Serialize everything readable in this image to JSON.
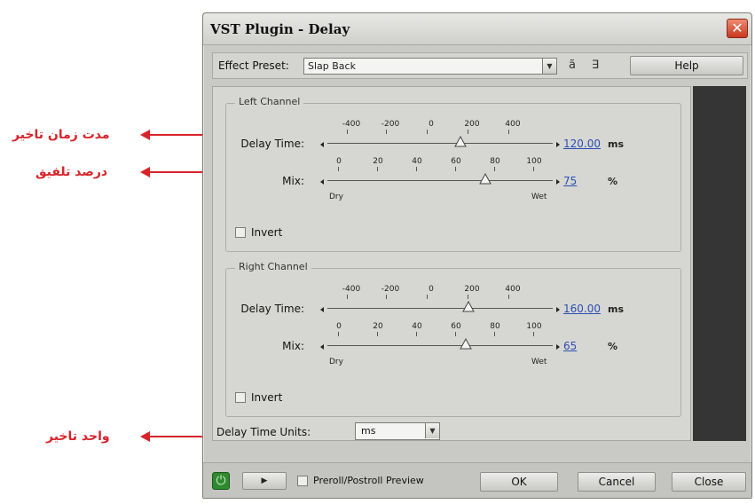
{
  "annotations": {
    "delay_time": "مدت زمان تاخیر",
    "mix": "درصد تلفیق",
    "units": "واحد تاخیر"
  },
  "dialog": {
    "title": "VST Plugin - Delay",
    "close_glyph": "✕"
  },
  "preset": {
    "label": "Effect Preset:",
    "value": "Slap Back",
    "help_label": "Help",
    "save_icon": "save-preset-icon",
    "delete_icon": "delete-preset-icon"
  },
  "left_channel": {
    "title": "Left Channel",
    "delay_label": "Delay Time:",
    "delay_value": "120.00",
    "delay_unit": "ms",
    "mix_label": "Mix:",
    "mix_value": "75",
    "mix_unit": "%",
    "dry": "Dry",
    "wet": "Wet",
    "invert_label": "Invert"
  },
  "right_channel": {
    "title": "Right Channel",
    "delay_label": "Delay Time:",
    "delay_value": "160.00",
    "delay_unit": "ms",
    "mix_label": "Mix:",
    "mix_value": "65",
    "mix_unit": "%",
    "dry": "Dry",
    "wet": "Wet",
    "invert_label": "Invert"
  },
  "delay_ticks": [
    "-400",
    "-200",
    "0",
    "200",
    "400"
  ],
  "mix_ticks": [
    "0",
    "20",
    "40",
    "60",
    "80",
    "100"
  ],
  "units": {
    "label": "Delay Time Units:",
    "value": "ms"
  },
  "bottom": {
    "preview_label": "Preroll/Postroll Preview",
    "ok": "OK",
    "cancel": "Cancel",
    "close": "Close"
  },
  "colors": {
    "annotation_red": "#d8232a",
    "link_blue": "#2d4fb0",
    "power_green": "#2e8a2e"
  }
}
